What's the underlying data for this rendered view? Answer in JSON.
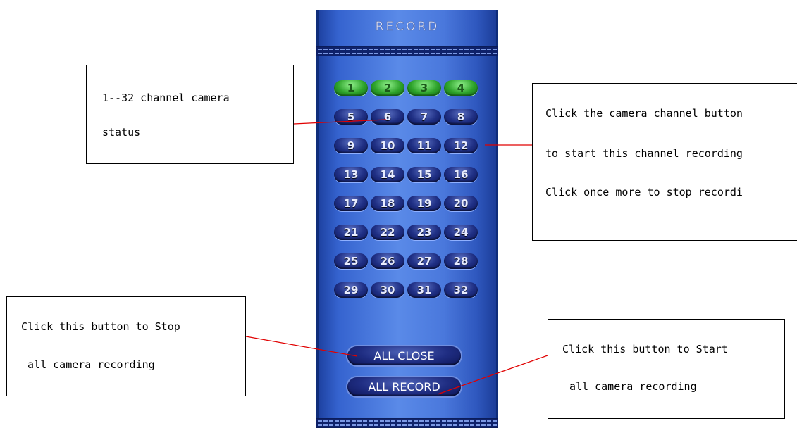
{
  "panel": {
    "title": "RECORD",
    "channels": [
      {
        "label": "1",
        "active": true
      },
      {
        "label": "2",
        "active": true
      },
      {
        "label": "3",
        "active": true
      },
      {
        "label": "4",
        "active": true
      },
      {
        "label": "5",
        "active": false
      },
      {
        "label": "6",
        "active": false
      },
      {
        "label": "7",
        "active": false
      },
      {
        "label": "8",
        "active": false
      },
      {
        "label": "9",
        "active": false
      },
      {
        "label": "10",
        "active": false
      },
      {
        "label": "11",
        "active": false
      },
      {
        "label": "12",
        "active": false
      },
      {
        "label": "13",
        "active": false
      },
      {
        "label": "14",
        "active": false
      },
      {
        "label": "15",
        "active": false
      },
      {
        "label": "16",
        "active": false
      },
      {
        "label": "17",
        "active": false
      },
      {
        "label": "18",
        "active": false
      },
      {
        "label": "19",
        "active": false
      },
      {
        "label": "20",
        "active": false
      },
      {
        "label": "21",
        "active": false
      },
      {
        "label": "22",
        "active": false
      },
      {
        "label": "23",
        "active": false
      },
      {
        "label": "24",
        "active": false
      },
      {
        "label": "25",
        "active": false
      },
      {
        "label": "26",
        "active": false
      },
      {
        "label": "27",
        "active": false
      },
      {
        "label": "28",
        "active": false
      },
      {
        "label": "29",
        "active": false
      },
      {
        "label": "30",
        "active": false
      },
      {
        "label": "31",
        "active": false
      },
      {
        "label": "32",
        "active": false
      }
    ],
    "all_close_label": "ALL CLOSE",
    "all_record_label": "ALL RECORD"
  },
  "callouts": {
    "status": {
      "line1": "1--32 channel camera",
      "line2": "status"
    },
    "channel_button": {
      "line1": "Click the camera channel button",
      "line2": "to start this channel recording",
      "line3": "Click once more to stop recordi"
    },
    "stop_all": {
      "line1": "Click this button to Stop",
      "line2": " all camera recording"
    },
    "start_all": {
      "line1": "Click this button to Start",
      "line2": "all camera recording"
    }
  },
  "colors": {
    "panel_blue": "#4a78dc",
    "active_channel": "#2ea32b",
    "inactive_channel": "#1f2f84",
    "leader_line": "#e00000"
  }
}
